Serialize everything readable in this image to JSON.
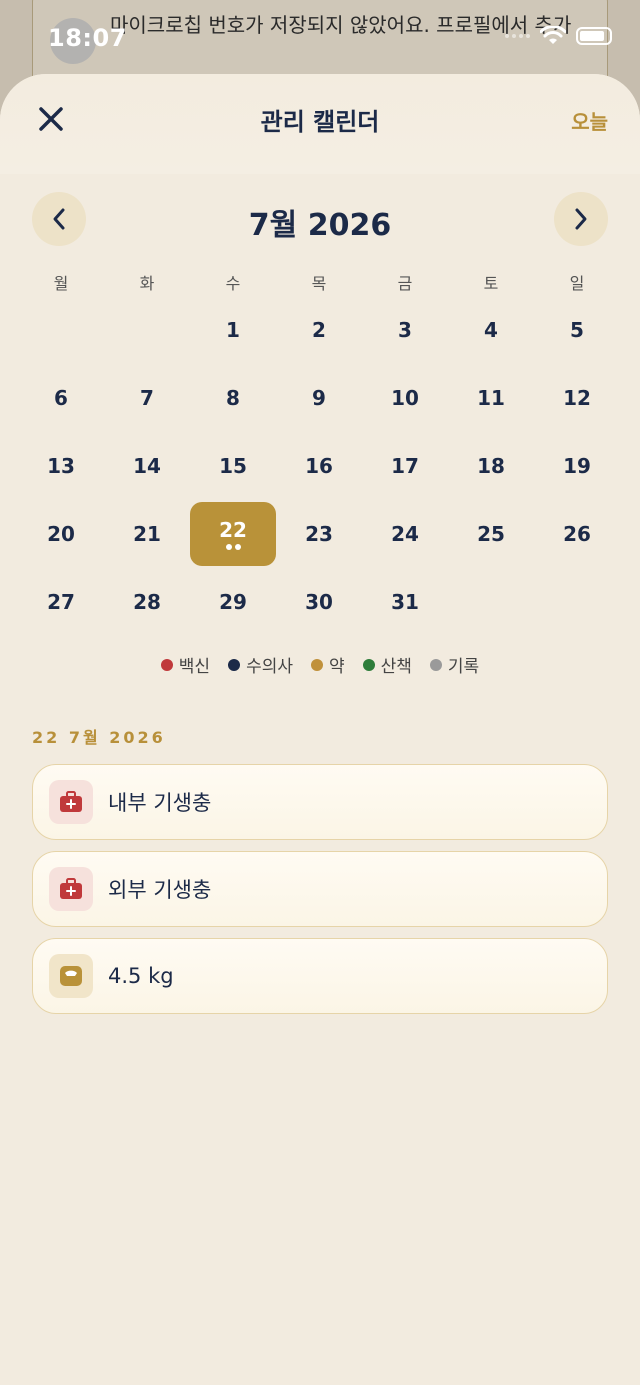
{
  "status_bar": {
    "time": "18:07"
  },
  "background": {
    "avatar_text": "🐕",
    "banner_text": "마이크로칩 번호가 저장되지 않았어요. 프로필에서 추가"
  },
  "header": {
    "title": "관리 캘린더",
    "today_label": "오늘"
  },
  "calendar": {
    "month_title": "7월 2026",
    "weekdays": [
      "월",
      "화",
      "수",
      "목",
      "금",
      "토",
      "일"
    ],
    "leading_blanks": 2,
    "days_in_month": 31,
    "selected_day": 22,
    "selected_day_dot_count": 2
  },
  "legend": [
    {
      "label": "백신",
      "color": "#c0393b"
    },
    {
      "label": "수의사",
      "color": "#1c2a48"
    },
    {
      "label": "약",
      "color": "#c0913b"
    },
    {
      "label": "산책",
      "color": "#2e7d3a"
    },
    {
      "label": "기록",
      "color": "#9a9a9a"
    }
  ],
  "selected_date_heading": "22 7월 2026",
  "events": [
    {
      "label": "내부 기생충",
      "icon": "medical-kit-icon",
      "icon_color": "#c0393b",
      "bg": "red"
    },
    {
      "label": "외부 기생충",
      "icon": "medical-kit-icon",
      "icon_color": "#c0393b",
      "bg": "red"
    },
    {
      "label": "4.5 kg",
      "icon": "weight-scale-icon",
      "icon_color": "#b99239",
      "bg": "gold"
    }
  ]
}
